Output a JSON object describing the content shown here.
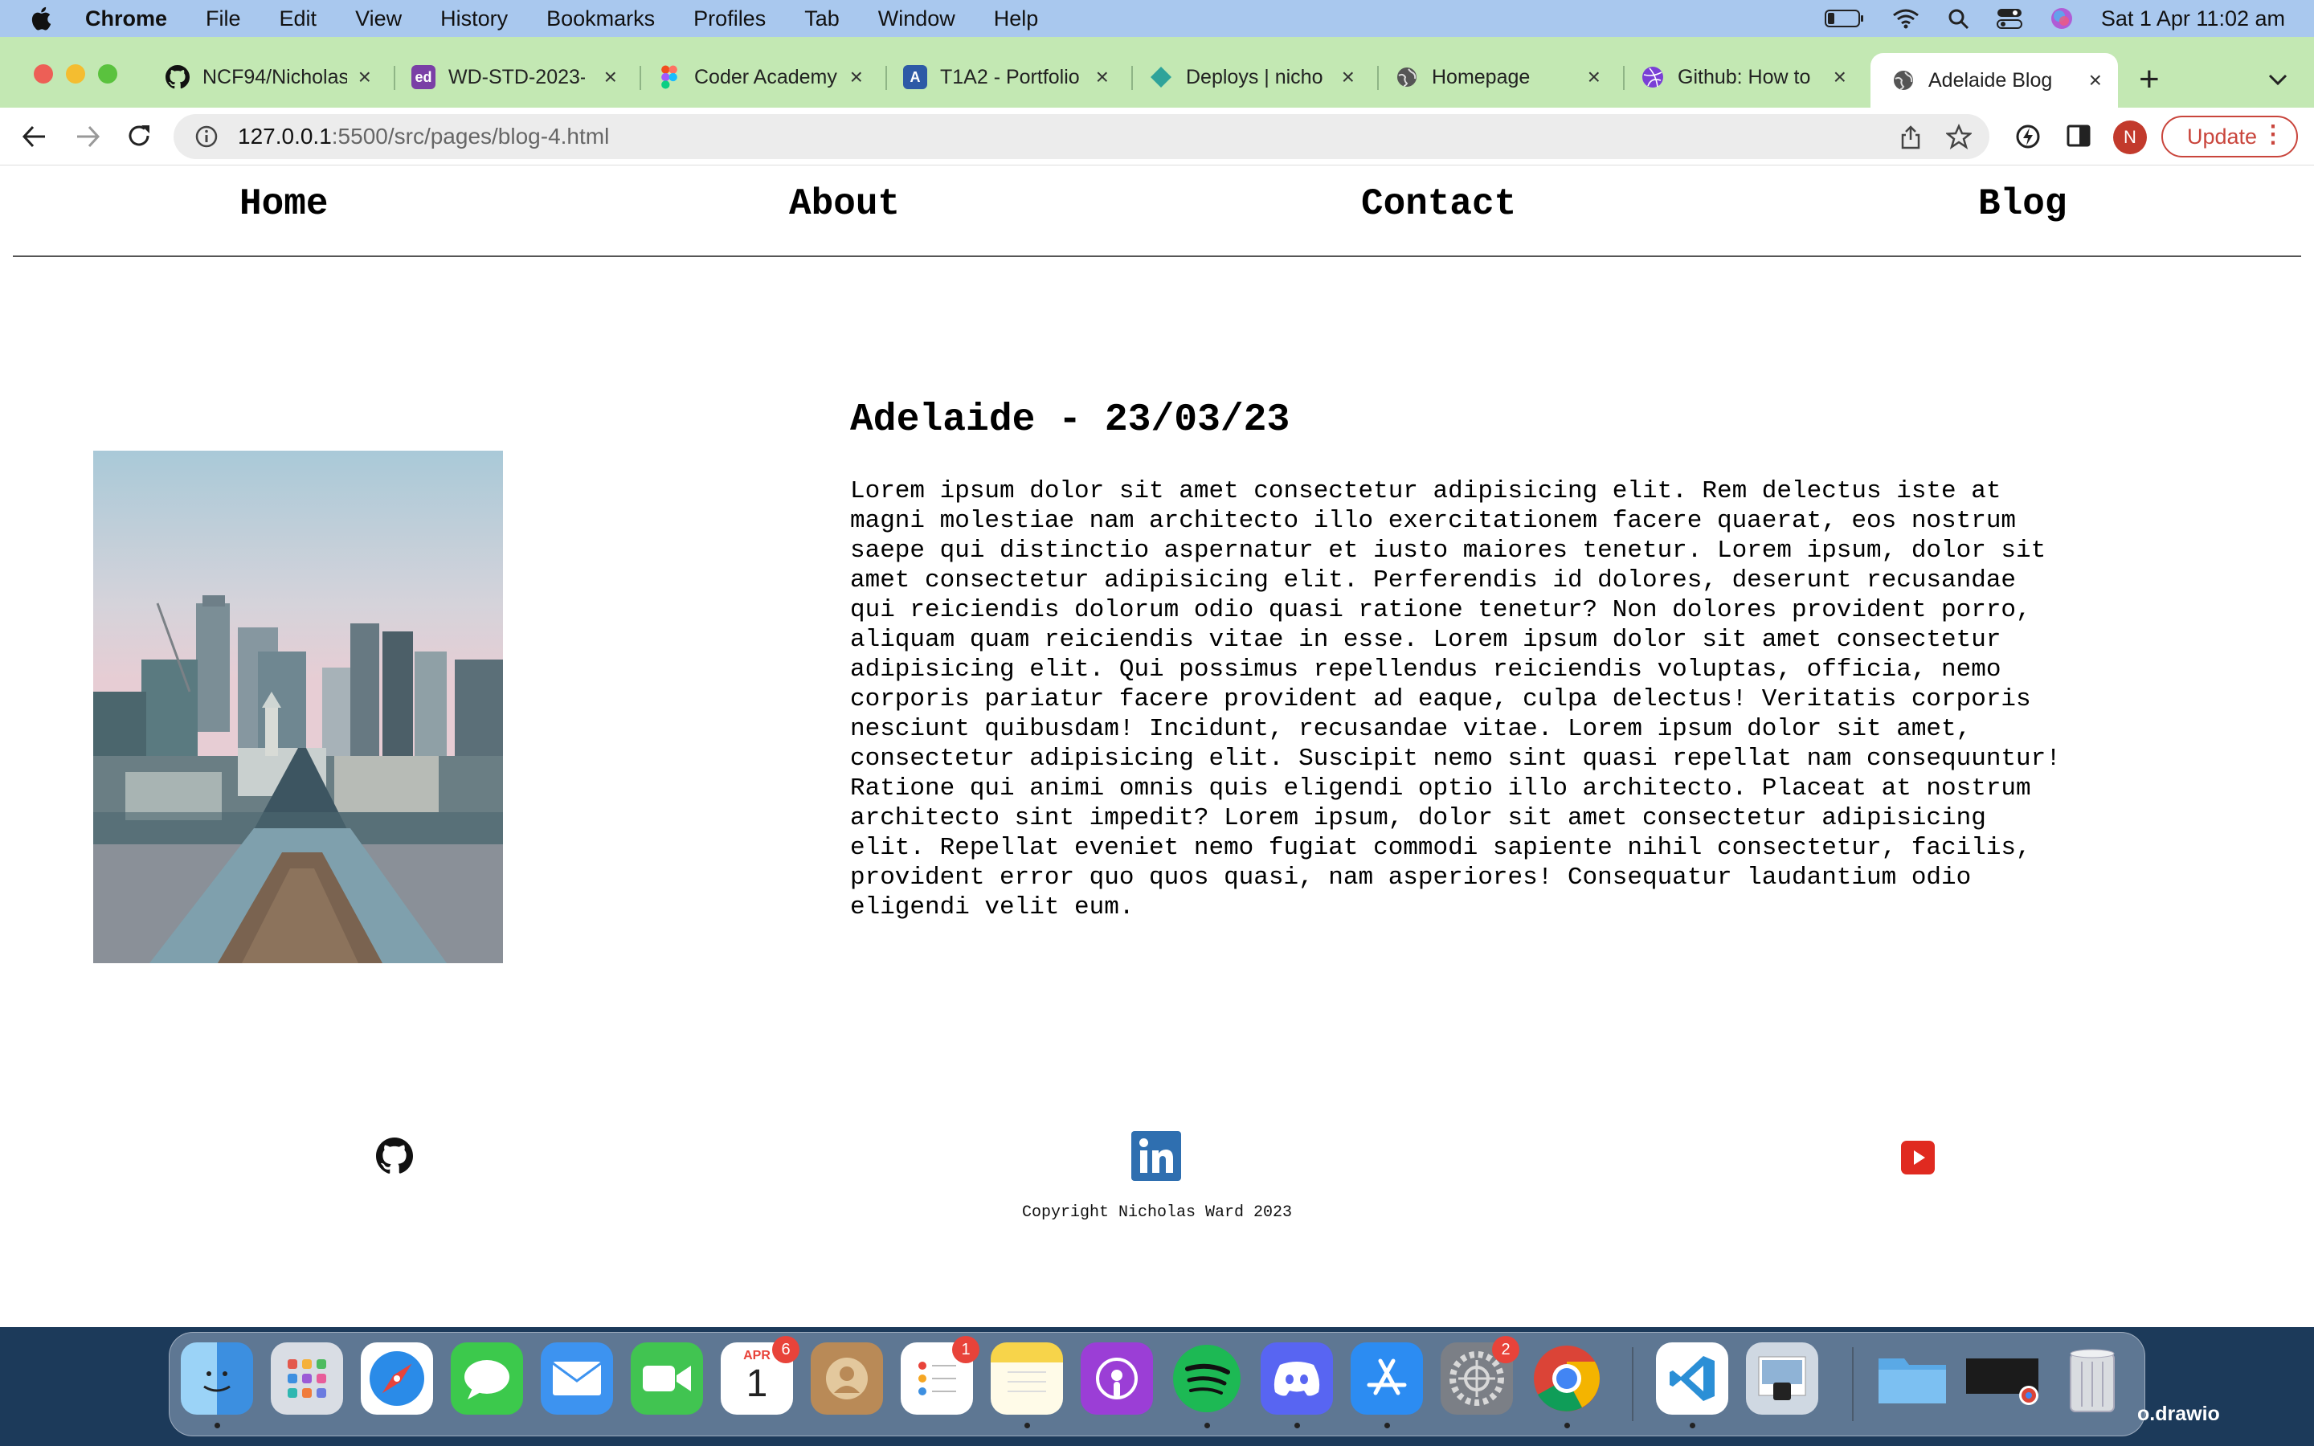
{
  "menubar": {
    "app_name": "Chrome",
    "items": [
      "File",
      "Edit",
      "View",
      "History",
      "Bookmarks",
      "Profiles",
      "Tab",
      "Window",
      "Help"
    ],
    "clock": "Sat 1 Apr  11:02 am"
  },
  "tabs": [
    {
      "title": "NCF94/Nicholas",
      "icon": "github-icon"
    },
    {
      "title": "WD-STD-2023-",
      "icon": "ed-icon"
    },
    {
      "title": "Coder Academy",
      "icon": "figma-icon"
    },
    {
      "title": "T1A2 - Portfolio",
      "icon": "canvas-icon"
    },
    {
      "title": "Deploys | nichol",
      "icon": "netlify-icon"
    },
    {
      "title": "Homepage",
      "icon": "globe-icon"
    },
    {
      "title": "Github: How to",
      "icon": "dribbble-icon"
    },
    {
      "title": "Adelaide Blog",
      "icon": "globe-icon",
      "active": true
    }
  ],
  "toolbar": {
    "url_host": "127.0.0.1",
    "url_rest": ":5500/src/pages/blog-4.html",
    "avatar_letter": "N",
    "update_label": "Update"
  },
  "nav": {
    "home": "Home",
    "about": "About",
    "contact": "Contact",
    "blog": "Blog"
  },
  "post": {
    "title": "Adelaide - 23/03/23",
    "body": "Lorem ipsum dolor sit amet consectetur adipisicing elit. Rem delectus iste at magni molestiae nam architecto illo exercitationem facere quaerat, eos nostrum saepe qui distinctio aspernatur et iusto maiores tenetur. Lorem ipsum, dolor sit amet consectetur adipisicing elit. Perferendis id dolores, deserunt recusandae qui reiciendis dolorum odio quasi ratione tenetur? Non dolores provident porro, aliquam quam reiciendis vitae in esse. Lorem ipsum dolor sit amet consectetur adipisicing elit. Qui possimus repellendus reiciendis voluptas, officia, nemo corporis pariatur facere provident ad eaque, culpa delectus! Veritatis corporis nesciunt quibusdam! Incidunt, recusandae vitae. Lorem ipsum dolor sit amet, consectetur adipisicing elit. Suscipit nemo sint quasi repellat nam consequuntur! Ratione qui animi omnis quis eligendi optio illo architecto. Placeat at nostrum architecto sint impedit? Lorem ipsum, dolor sit amet consectetur adipisicing elit. Repellat eveniet nemo fugiat commodi sapiente nihil consectetur, facilis, provident error quo quos quasi, nam asperiores! Consequatur laudantium odio eligendi velit eum."
  },
  "footer": {
    "copyright": "Copyright Nicholas Ward 2023",
    "icons": [
      "github-icon",
      "linkedin-icon",
      "youtube-icon"
    ]
  },
  "dock": {
    "calendar_month": "APR",
    "calendar_day": "1",
    "calendar_badge": "6",
    "reminders_badge": "1",
    "settings_badge": "2",
    "desktop_label": "o.drawio"
  },
  "colors": {
    "menubar": "#a9c8ee",
    "tabstrip": "#c3e8b3",
    "update_accent": "#c9453c",
    "linkedin": "#2f6fb0",
    "youtube": "#e02a20"
  }
}
